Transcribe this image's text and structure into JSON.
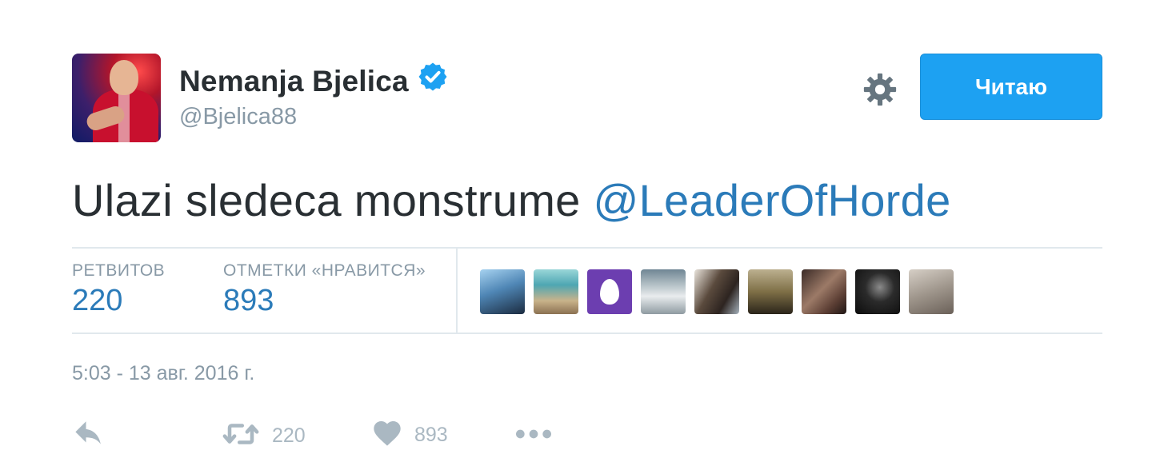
{
  "user": {
    "display_name": "Nemanja Bjelica",
    "handle": "@Bjelica88",
    "verified": true
  },
  "follow_button": {
    "label": "Читаю"
  },
  "tweet": {
    "text": "Ulazi sledeca monstrume ",
    "mention": "@LeaderOfHorde"
  },
  "stats": {
    "retweets_label": "РЕТВИТОВ",
    "retweets_value": "220",
    "likes_label": "ОТМЕТКИ «НРАВИТСЯ»",
    "likes_value": "893"
  },
  "timestamp": "5:03 - 13 авг. 2016 г.",
  "actions": {
    "retweet_count": "220",
    "like_count": "893"
  },
  "colors": {
    "accent": "#1da1f2",
    "link": "#2b7bb9",
    "muted": "#8899a6",
    "text": "#292f33"
  },
  "icons": [
    "verified-badge-icon",
    "gear-icon",
    "reply-icon",
    "retweet-icon",
    "heart-icon",
    "more-icon"
  ]
}
